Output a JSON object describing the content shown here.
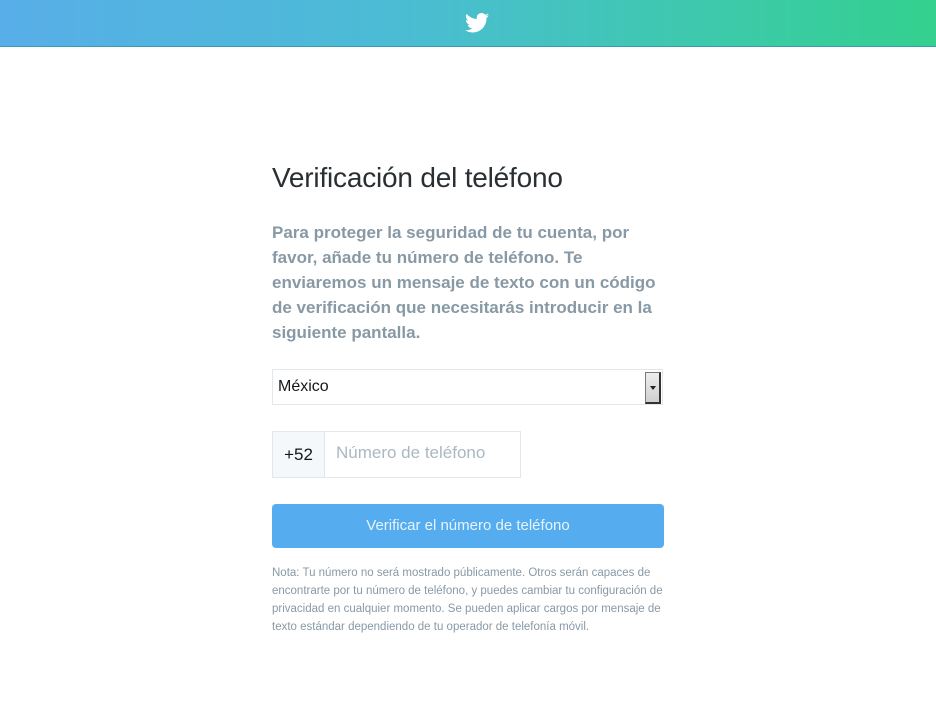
{
  "header": {
    "logo_icon": "twitter-bird-icon",
    "gradient_start": "#58aee8",
    "gradient_end": "#33d08e"
  },
  "main": {
    "title": "Verificación del teléfono",
    "description": "Para proteger la seguridad de tu cuenta, por favor, añade tu número de teléfono. Te enviaremos un mensaje de texto con un código de verificación que necesitarás introducir en la siguiente pantalla.",
    "country_select": {
      "value": "México"
    },
    "phone": {
      "prefix": "+52",
      "placeholder": "Número de teléfono",
      "value": ""
    },
    "verify_button_label": "Verificar el número de teléfono",
    "note": "Nota: Tu número no será mostrado públicamente. Otros serán capaces de encontrarte por tu número de teléfono, y puedes cambiar tu configuración de privacidad en cualquier momento. Se pueden aplicar cargos por mensaje de texto estándar dependiendo de tu operador de telefonía móvil."
  },
  "colors": {
    "accent": "#55acee",
    "text_primary": "#292f33",
    "text_secondary": "#8899a6",
    "border": "#e1e8ed"
  }
}
